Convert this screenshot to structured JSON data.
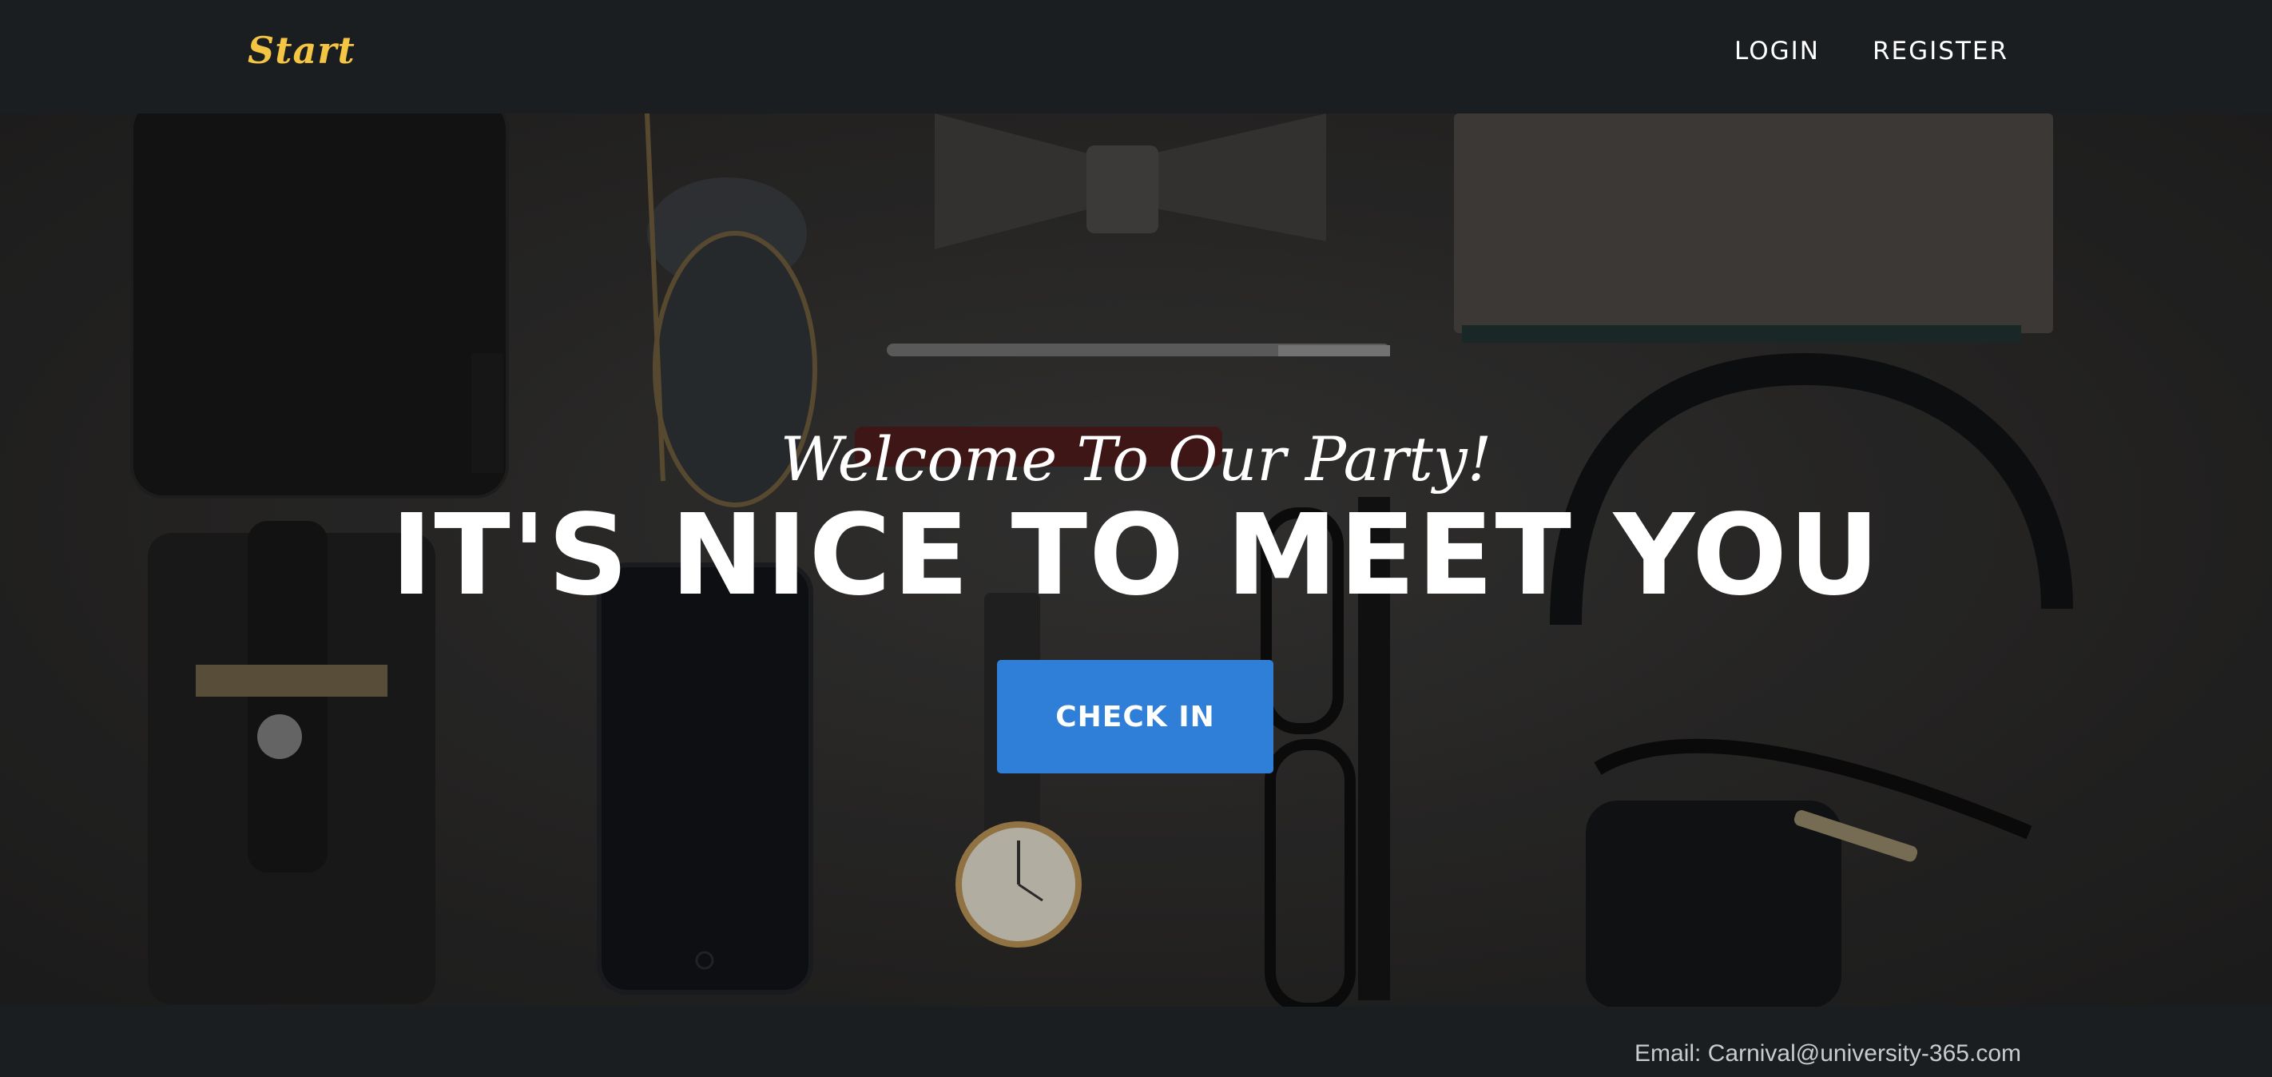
{
  "navbar": {
    "brand": "Start",
    "links": [
      {
        "label": "LOGIN"
      },
      {
        "label": "REGISTER"
      }
    ]
  },
  "hero": {
    "subtitle": "Welcome To Our Party!",
    "title": "IT'S NICE TO MEET YOU",
    "cta_label": "CHECK IN"
  },
  "footer": {
    "email_text": "Email: Carnival@university-365.com"
  },
  "colors": {
    "brand": "#f4c542",
    "accent": "#2f7fd8",
    "nav_background": "#1b1e21",
    "text": "#ffffff"
  }
}
